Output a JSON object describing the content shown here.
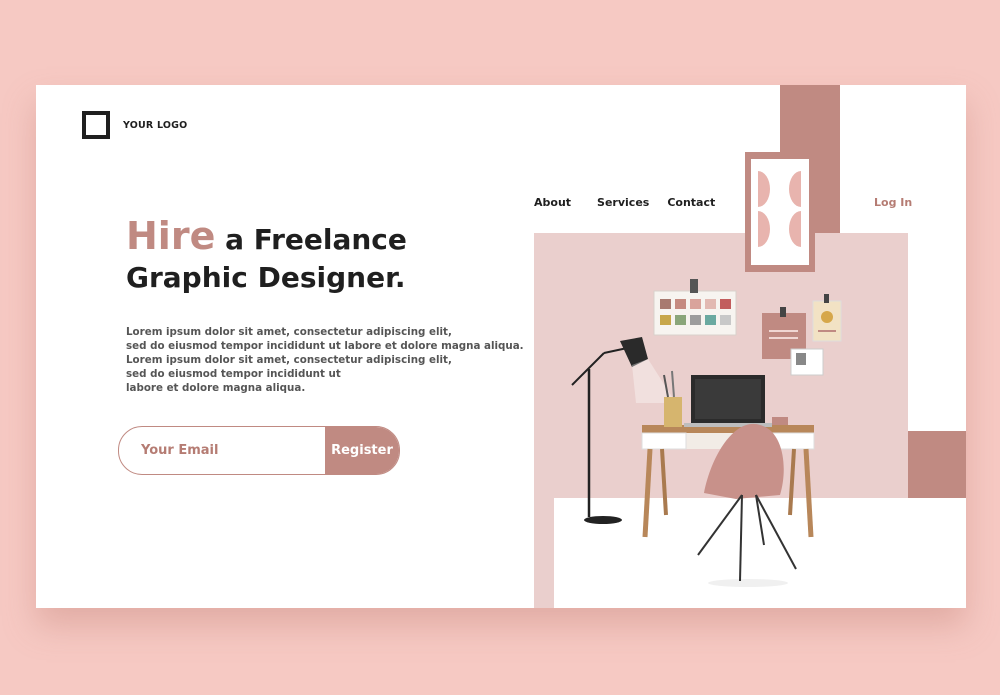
{
  "header": {
    "logo_text": "YOUR LOGO"
  },
  "nav": {
    "about": "About",
    "services": "Services",
    "contact": "Contact",
    "login": "Log In"
  },
  "hero": {
    "headline_accent": "Hire",
    "headline_rest": "a Freelance",
    "headline_line2": "Graphic Designer.",
    "body_lines": [
      "Lorem ipsum dolor sit amet, consectetur adipiscing elit,",
      "sed do eiusmod tempor incididunt ut labore et dolore magna aliqua.",
      "Lorem ipsum dolor sit amet, consectetur adipiscing elit,",
      "sed do eiusmod tempor incididunt ut",
      "labore et dolore magna aliqua."
    ]
  },
  "form": {
    "email_placeholder": "Your Email",
    "register_label": "Register"
  },
  "colors": {
    "background": "#f6c9c3",
    "accent": "#c08a82",
    "accent_dark": "#b57c73",
    "wall": "#eacfcd"
  },
  "icons": [
    "logo-square-icon"
  ]
}
